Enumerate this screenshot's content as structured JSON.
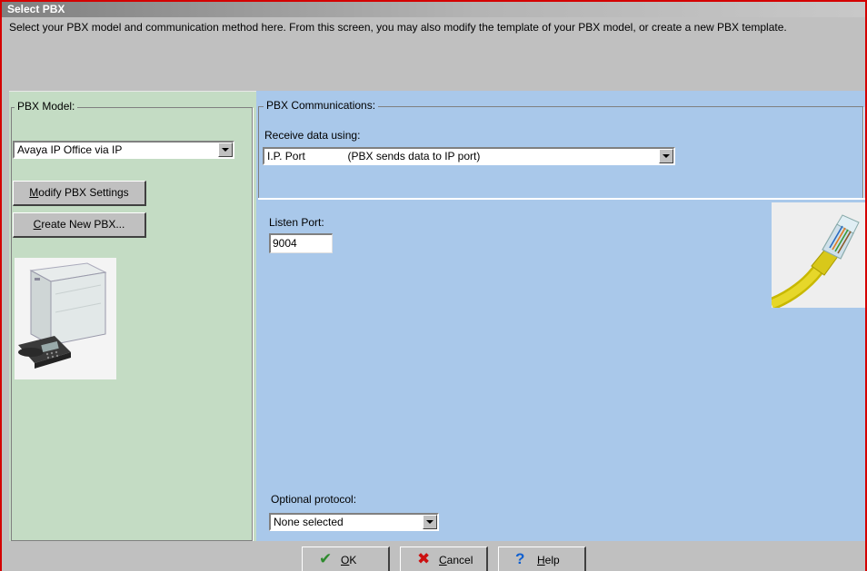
{
  "window": {
    "title": "Select PBX",
    "instructions": "Select your PBX model and communication method here.  From this screen, you may also modify the template of your PBX model, or create a new PBX template."
  },
  "pbx_model": {
    "group_label": "PBX Model:",
    "selected_model": "Avaya IP Office via IP",
    "modify_button": {
      "mnemonic": "M",
      "rest": "odify PBX Settings"
    },
    "create_button": {
      "mnemonic": "C",
      "rest": "reate New PBX..."
    },
    "image": "pbx-system-with-phone"
  },
  "pbx_comm": {
    "group_label": "PBX Communications:",
    "receive_label": "Receive data using:",
    "receive_selected": "I.P. Port              (PBX sends data to IP port)",
    "listen_port_label": "Listen Port:",
    "listen_port_value": "9004",
    "image": "ethernet-cable",
    "optional_protocol_label": "Optional protocol:",
    "optional_protocol_value": "None selected"
  },
  "footer": {
    "ok": {
      "mnemonic": "O",
      "rest": "K",
      "icon": "check-icon"
    },
    "cancel": {
      "mnemonic": "C",
      "rest": "ancel",
      "icon": "x-icon"
    },
    "help": {
      "mnemonic": "H",
      "rest": "elp",
      "icon": "question-icon"
    }
  },
  "colors": {
    "left_panel": "#c4dcc4",
    "right_panel": "#a9c8ea",
    "window_edge": "#d40000",
    "ok_icon": "#2e8b2e",
    "cancel_icon": "#cc1010",
    "help_icon": "#1060d0"
  }
}
